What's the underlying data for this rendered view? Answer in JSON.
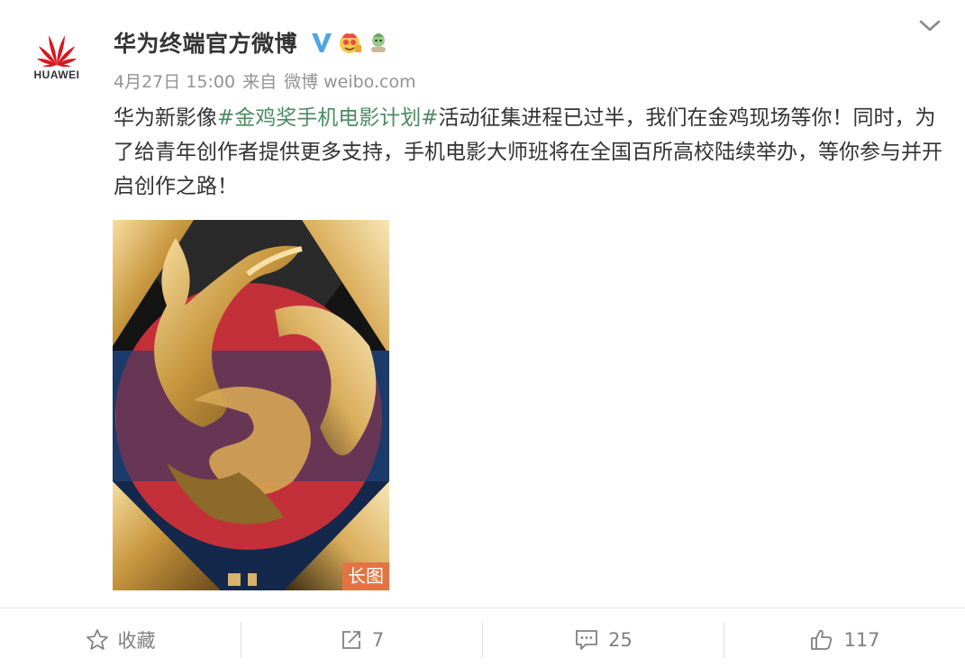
{
  "post": {
    "author": "华为终端官方微博",
    "avatar_brand": "HUAWEI",
    "verified_icon": "verified-v-icon",
    "badge_icon": "member-emoji-badge",
    "time": "4月27日 15:00",
    "source_prefix": "来自",
    "source": "微博 weibo.com",
    "text_before": "华为新影像",
    "hashtag": "#金鸡奖手机电影计划#",
    "text_after": "活动征集进程已过半，我们在金鸡现场等你！同时，为了给青年创作者提供更多支持，手机电影大师班将在全国百所高校陆续举办，等你参与并开启创作之路！",
    "image_badge": "长图"
  },
  "actions": {
    "favorite_label": "收藏",
    "repost_count": "7",
    "comment_count": "25",
    "like_count": "117"
  },
  "colors": {
    "hashtag": "#4c8a63",
    "meta": "#939393",
    "badge_bg": "#e27444",
    "verified": "#4ea5e6"
  }
}
